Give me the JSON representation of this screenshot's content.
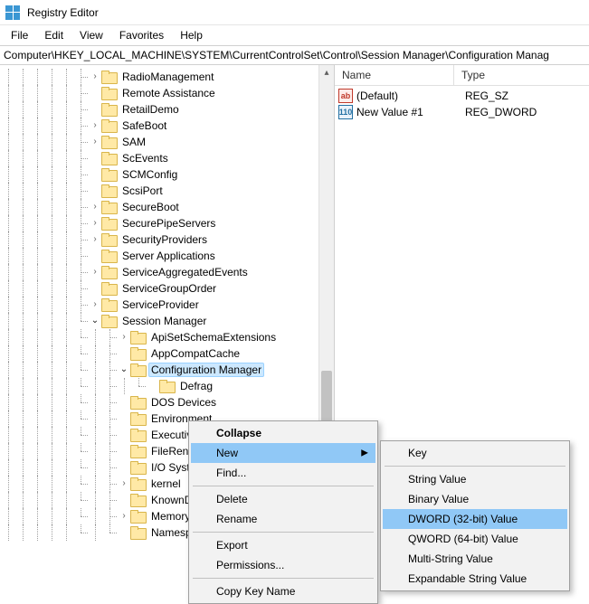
{
  "window": {
    "title": "Registry Editor"
  },
  "menubar": [
    "File",
    "Edit",
    "View",
    "Favorites",
    "Help"
  ],
  "address": "Computer\\HKEY_LOCAL_MACHINE\\SYSTEM\\CurrentControlSet\\Control\\Session Manager\\Configuration Manag",
  "tree": {
    "items": [
      {
        "label": "RadioManagement",
        "exp": ">"
      },
      {
        "label": "Remote Assistance"
      },
      {
        "label": "RetailDemo"
      },
      {
        "label": "SafeBoot",
        "exp": ">"
      },
      {
        "label": "SAM",
        "exp": ">"
      },
      {
        "label": "ScEvents"
      },
      {
        "label": "SCMConfig"
      },
      {
        "label": "ScsiPort"
      },
      {
        "label": "SecureBoot",
        "exp": ">"
      },
      {
        "label": "SecurePipeServers",
        "exp": ">"
      },
      {
        "label": "SecurityProviders",
        "exp": ">"
      },
      {
        "label": "Server Applications"
      },
      {
        "label": "ServiceAggregatedEvents",
        "exp": ">"
      },
      {
        "label": "ServiceGroupOrder"
      },
      {
        "label": "ServiceProvider",
        "exp": ">"
      },
      {
        "label": "Session Manager",
        "exp": "v",
        "children": [
          {
            "label": "ApiSetSchemaExtensions",
            "exp": ">"
          },
          {
            "label": "AppCompatCache"
          },
          {
            "label": "Configuration Manager",
            "exp": "v",
            "selected": true,
            "children": [
              {
                "label": "Defrag"
              }
            ]
          },
          {
            "label": "DOS Devices"
          },
          {
            "label": "Environment"
          },
          {
            "label": "Executive"
          },
          {
            "label": "FileRenameOper"
          },
          {
            "label": "I/O System"
          },
          {
            "label": "kernel",
            "exp": ">"
          },
          {
            "label": "KnownDLLs"
          },
          {
            "label": "Memory Manage",
            "exp": ">"
          },
          {
            "label": "NamespaceSepa"
          }
        ]
      }
    ]
  },
  "list": {
    "columns": {
      "name": "Name",
      "type": "Type"
    },
    "rows": [
      {
        "icon": "sz",
        "name": "(Default)",
        "type": "REG_SZ"
      },
      {
        "icon": "dw",
        "name": "New Value #1",
        "type": "REG_DWORD"
      }
    ]
  },
  "context_menu": {
    "items": [
      {
        "label": "Collapse",
        "bold": true
      },
      {
        "label": "New",
        "submenu": true,
        "highlight": true
      },
      {
        "label": "Find..."
      },
      {
        "sep": true
      },
      {
        "label": "Delete"
      },
      {
        "label": "Rename"
      },
      {
        "sep": true
      },
      {
        "label": "Export"
      },
      {
        "label": "Permissions..."
      },
      {
        "sep": true
      },
      {
        "label": "Copy Key Name"
      }
    ]
  },
  "submenu": {
    "items": [
      {
        "label": "Key"
      },
      {
        "sep": true
      },
      {
        "label": "String Value"
      },
      {
        "label": "Binary Value"
      },
      {
        "label": "DWORD (32-bit) Value",
        "highlight": true
      },
      {
        "label": "QWORD (64-bit) Value"
      },
      {
        "label": "Multi-String Value"
      },
      {
        "label": "Expandable String Value"
      }
    ]
  }
}
